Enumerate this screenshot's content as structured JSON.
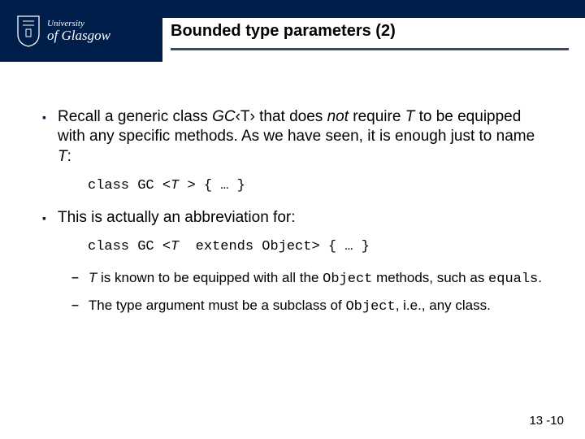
{
  "header": {
    "university_top": "University",
    "university_of": "of",
    "university_name": "Glasgow",
    "title": "Bounded type parameters (2)"
  },
  "bullets": {
    "b1_pre": "Recall a generic class ",
    "b1_gc": "GC",
    "b1_angle": "‹T›",
    "b1_mid1": " that does ",
    "b1_not": "not",
    "b1_mid2": " require ",
    "b1_T": "T",
    "b1_mid3": " to be equipped with any specific methods. As we have seen, it is enough just to name ",
    "b1_T2": "T",
    "b1_end": ":",
    "code1_a": "class GC <",
    "code1_t": "T ",
    "code1_b": "> { … }",
    "b2": "This is actually an abbreviation for:",
    "code2_a": "class GC <",
    "code2_t": "T ",
    "code2_b": " extends Object> { … }",
    "sub1_pre": "",
    "sub1_T": "T",
    "sub1_mid": " is known to be equipped with all the ",
    "sub1_obj": "Object",
    "sub1_mid2": " methods, such as ",
    "sub1_eq": "equals",
    "sub1_end": ".",
    "sub2_pre": "The type argument must be a subclass of ",
    "sub2_obj": "Object",
    "sub2_end": ", i.e., any class."
  },
  "page": "13 -10"
}
